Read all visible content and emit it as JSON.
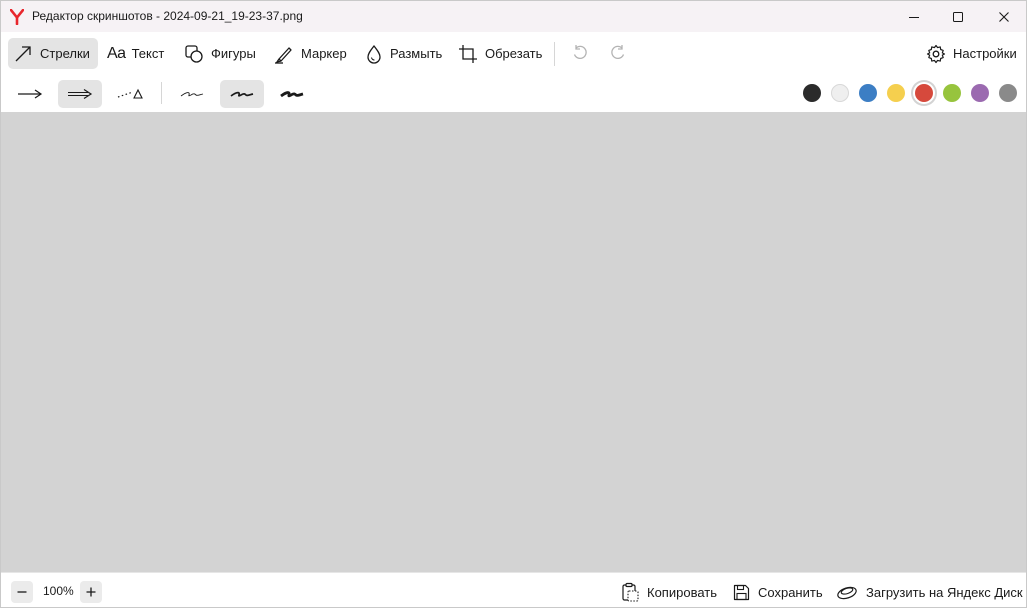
{
  "window": {
    "title": "Редактор скриншотов - 2024-09-21_19-23-37.png",
    "logo_letter": "Y",
    "logo_color": "#e8262d"
  },
  "toolbar": {
    "tools": [
      {
        "id": "arrows",
        "label": "Стрелки",
        "icon": "arrow-icon",
        "active": true
      },
      {
        "id": "text",
        "label": "Текст",
        "icon": "text-aa-icon",
        "active": false
      },
      {
        "id": "shapes",
        "label": "Фигуры",
        "icon": "shapes-icon",
        "active": false
      },
      {
        "id": "marker",
        "label": "Маркер",
        "icon": "marker-icon",
        "active": false
      },
      {
        "id": "blur",
        "label": "Размыть",
        "icon": "drop-icon",
        "active": false
      },
      {
        "id": "crop",
        "label": "Обрезать",
        "icon": "crop-icon",
        "active": false
      }
    ],
    "undo_icon": "undo-icon",
    "redo_icon": "redo-icon",
    "settings_label": "Настройки",
    "settings_icon": "gear-icon"
  },
  "subbar": {
    "arrow_styles": [
      "arrow-open",
      "arrow-double-line",
      "arrow-dotted"
    ],
    "arrow_style_selected": 1,
    "line_widths": [
      "thin",
      "medium",
      "thick"
    ],
    "line_width_selected": 1,
    "colors": [
      "#2b2b2b",
      "#efefef",
      "#3c7ec4",
      "#f5cf4e",
      "#d6493c",
      "#97c43d",
      "#9b6ab0",
      "#8a8a8a"
    ],
    "color_selected": 4
  },
  "canvas": {
    "background": "#d3d3d3"
  },
  "statusbar": {
    "zoom_out_icon": "minus-icon",
    "zoom_value": "100%",
    "zoom_in_icon": "plus-icon",
    "copy_label": "Копировать",
    "save_label": "Сохранить",
    "upload_label": "Загрузить на Яндекс Диск"
  }
}
